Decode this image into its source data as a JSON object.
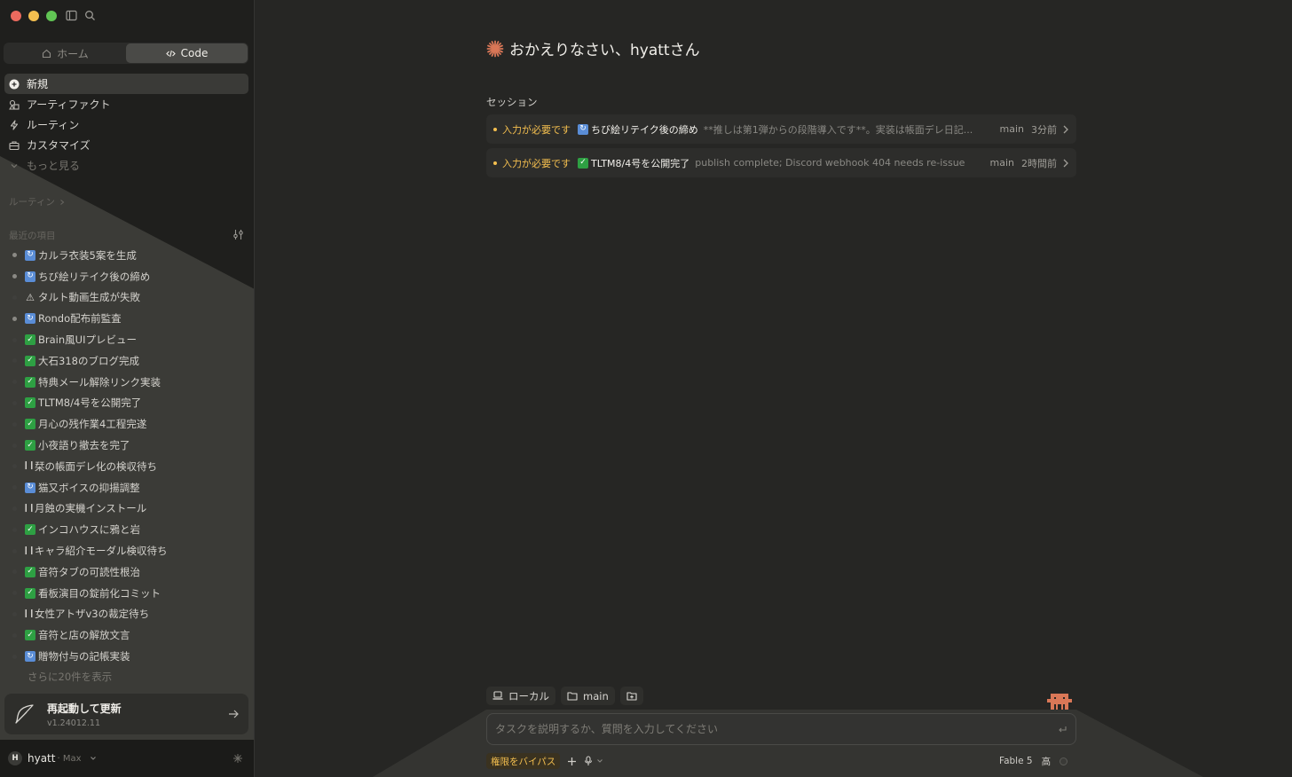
{
  "sidebar": {
    "modes": [
      {
        "label": "ホーム",
        "active": false
      },
      {
        "label": "Code",
        "active": true
      }
    ],
    "nav": [
      {
        "label": "新規",
        "icon": "plus-icon"
      },
      {
        "label": "アーティファクト",
        "icon": "shapes-icon"
      },
      {
        "label": "ルーティン",
        "icon": "bolt-icon"
      },
      {
        "label": "カスタマイズ",
        "icon": "briefcase-icon"
      },
      {
        "label": "もっと見る",
        "icon": "chevron-down-icon"
      }
    ],
    "routine_label": "ルーティン",
    "recent_label": "最近の項目",
    "recent": [
      {
        "label": "カルラ衣装5案を生成",
        "status": "cycle",
        "active": true
      },
      {
        "label": "ちび絵リテイク後の締め",
        "status": "cycle",
        "active": true
      },
      {
        "label": "タルト動画生成が失敗",
        "status": "warn",
        "active": false
      },
      {
        "label": "Rondo配布前監査",
        "status": "cycle",
        "active": true
      },
      {
        "label": "Brain風UIプレビュー",
        "status": "check",
        "active": false
      },
      {
        "label": "大石318のブログ完成",
        "status": "check",
        "active": false
      },
      {
        "label": "特典メール解除リンク実装",
        "status": "check",
        "active": false
      },
      {
        "label": "TLTM8/4号を公開完了",
        "status": "check",
        "active": false
      },
      {
        "label": "月心の残作業4工程完遂",
        "status": "check",
        "active": false
      },
      {
        "label": "小夜語り撤去を完了",
        "status": "check",
        "active": false
      },
      {
        "label": "栞の帳面デレ化の検収待ち",
        "status": "pause",
        "active": false
      },
      {
        "label": "猫又ボイスの抑揚調整",
        "status": "cycle",
        "active": false
      },
      {
        "label": "月蝕の実機インストール",
        "status": "pause",
        "active": false
      },
      {
        "label": "インコハウスに鴉と岩",
        "status": "check",
        "active": false
      },
      {
        "label": "キャラ紹介モーダル検収待ち",
        "status": "pause",
        "active": false
      },
      {
        "label": "音符タブの可読性根治",
        "status": "check",
        "active": false
      },
      {
        "label": "看板演目の錠前化コミット",
        "status": "check",
        "active": false
      },
      {
        "label": "女性アトザv3の裁定待ち",
        "status": "pause",
        "active": false
      },
      {
        "label": "音符と店の解放文言",
        "status": "check",
        "active": false
      },
      {
        "label": "贈物付与の記帳実装",
        "status": "cycle",
        "active": false
      }
    ],
    "more_recent": "さらに20件を表示",
    "update": {
      "title": "再起動して更新",
      "version": "v1.24012.11"
    },
    "user": {
      "initial": "H",
      "name": "hyatt",
      "plan": "· Max"
    }
  },
  "main": {
    "greeting": "おかえりなさい、hyattさん",
    "sessions_label": "セッション",
    "sessions": [
      {
        "status": "入力が必要です",
        "icon": "cycle",
        "title": "ちび絵リテイク後の締め",
        "desc": "**推しは第1弾からの段階導入です**。実装は帳面デレ日記...",
        "branch": "main",
        "time": "3分前"
      },
      {
        "status": "入力が必要です",
        "icon": "check",
        "title": "TLTM8/4号を公開完了",
        "desc": "publish complete; Discord webhook 404 needs re-issue",
        "branch": "main",
        "time": "2時間前"
      }
    ],
    "chips": {
      "local": "ローカル",
      "branch": "main"
    },
    "input_placeholder": "タスクを説明するか、質問を入力してください",
    "bypass": "権限をバイパス",
    "model": "Fable 5",
    "effort": "高"
  },
  "colors": {
    "accent": "#d97757",
    "warning": "#f4bf4f",
    "check": "#2ea043",
    "background": "#262624",
    "sidebar": "#1f1f1d"
  }
}
